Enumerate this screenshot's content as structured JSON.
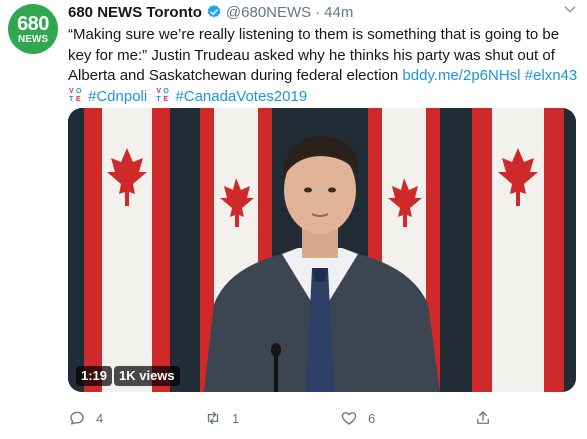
{
  "account": {
    "avatar_line1": "680",
    "avatar_line2": "NEWS",
    "name": "680 NEWS Toronto",
    "handle": "@680NEWS",
    "separator": "·",
    "time": "44m"
  },
  "tweet": {
    "text": "“Making sure we’re really listening to them is something that is going to be key for me:” Justin Trudeau asked why he thinks his party was shut out of Alberta and Saskatchewan during federal election",
    "link": "bddy.me/2p6NHsl",
    "hashtags": [
      "#elxn43",
      "#Cdnpoli",
      "#CanadaVotes2019"
    ],
    "vote_emoji_letters": [
      "V",
      "O",
      "T",
      "E"
    ]
  },
  "video": {
    "duration": "1:19",
    "views": "1K views"
  },
  "actions": {
    "replies": "4",
    "retweets": "1",
    "likes": "6"
  },
  "colors": {
    "brand_green": "#2fa84f",
    "link_blue": "#1b95e0",
    "muted_gray": "#657786",
    "flag_red": "#d62a2a"
  }
}
